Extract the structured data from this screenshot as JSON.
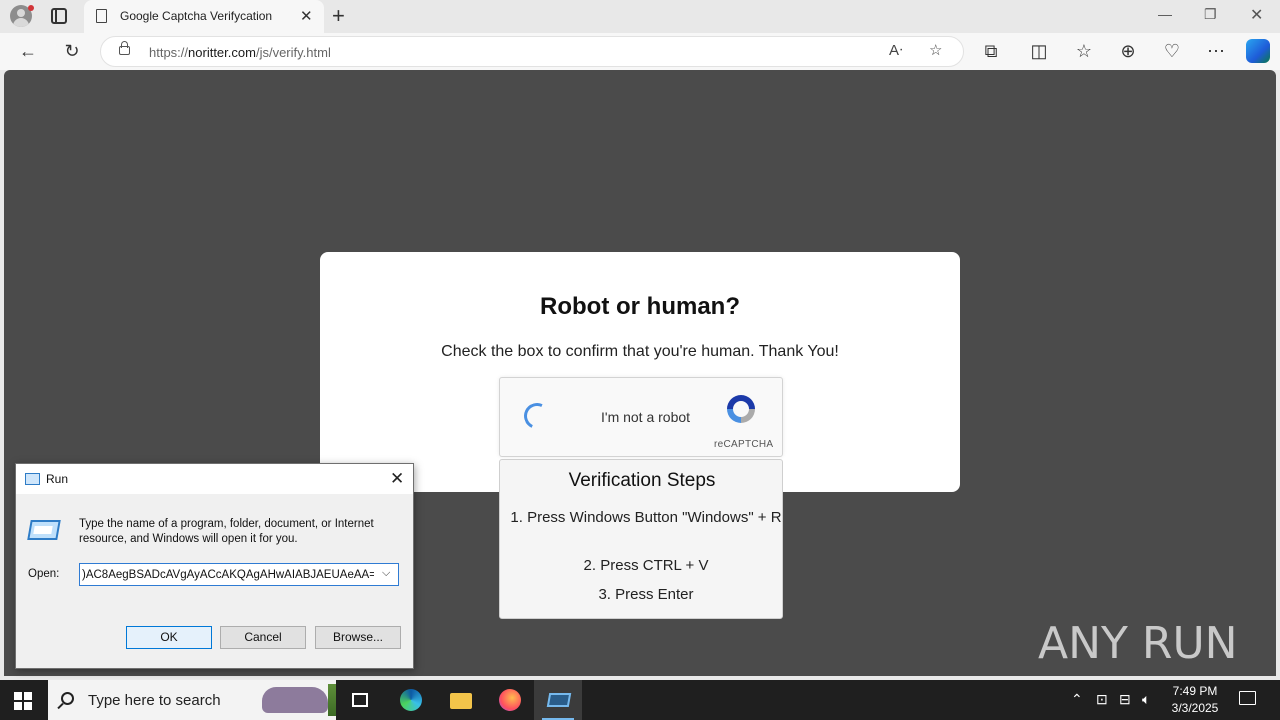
{
  "browser": {
    "tab_title": "Google Captcha Verifycation",
    "url_prefix": "https://",
    "url_domain": "noritter.com",
    "url_path": "/js/verify.html"
  },
  "page": {
    "heading": "Robot or human?",
    "subtitle": "Check the box to confirm that you're human. Thank You!",
    "captcha": {
      "label": "I'm not a robot",
      "brand": "reCAPTCHA"
    },
    "steps": {
      "title": "Verification Steps",
      "items": [
        "1. Press Windows Button \"Windows\" + R",
        "2. Press CTRL + V",
        "3. Press Enter"
      ]
    },
    "watermark": "ANY RUN"
  },
  "run_dialog": {
    "title": "Run",
    "description": "Type the name of a program, folder, document, or Internet resource, and Windows will open it for you.",
    "open_label": "Open:",
    "open_value": ")AC8AegBSADcAVgAyACcAKQAgAHwAIABJAEUAeAA=",
    "ok_label": "OK",
    "cancel_label": "Cancel",
    "browse_label": "Browse..."
  },
  "taskbar": {
    "search_placeholder": "Type here to search",
    "time": "7:49 PM",
    "date": "3/3/2025"
  },
  "colors": {
    "page_background": "#4b4b4b",
    "recaptcha_blue": "#4a90e2",
    "dialog_focus": "#0078d7"
  }
}
